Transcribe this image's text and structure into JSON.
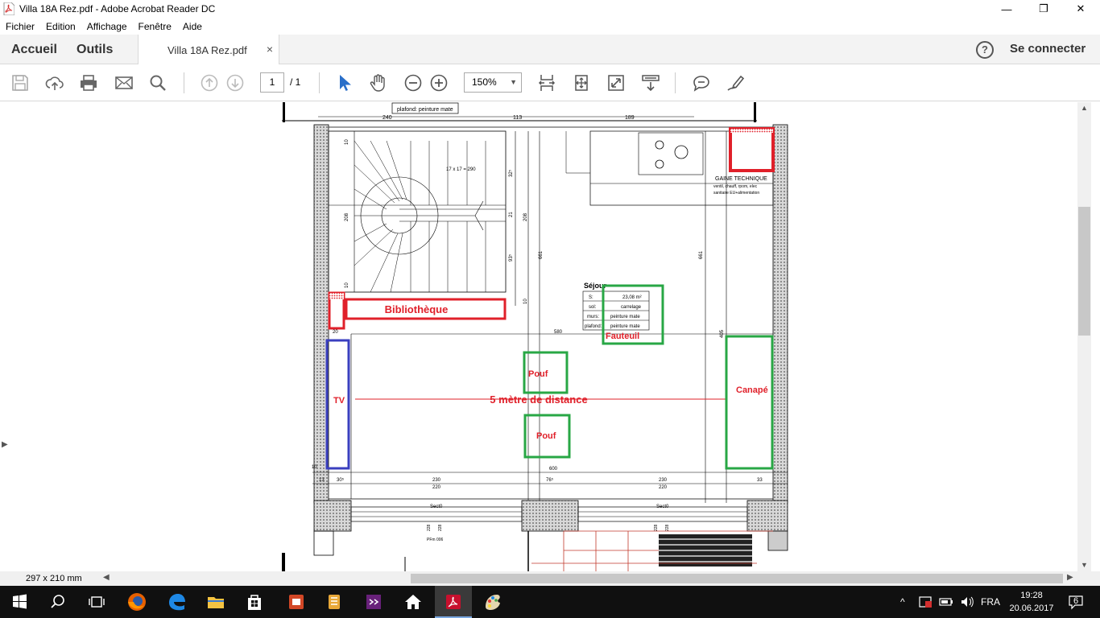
{
  "window": {
    "title": "Villa 18A Rez.pdf - Adobe Acrobat Reader DC",
    "minimize": "—",
    "maximize": "❐",
    "close": "✕"
  },
  "menu": [
    "Fichier",
    "Edition",
    "Affichage",
    "Fenêtre",
    "Aide"
  ],
  "tabs": {
    "home": "Accueil",
    "tools": "Outils",
    "document": "Villa 18A Rez.pdf",
    "close": "×"
  },
  "account": {
    "help": "?",
    "sign_in": "Se connecter"
  },
  "toolbar": {
    "icons": [
      "save-icon",
      "upload-icon",
      "print-icon",
      "email-icon",
      "search-icon",
      "prev-page-icon",
      "next-page-icon",
      "select-cursor-icon",
      "hand-icon",
      "zoom-out-icon",
      "zoom-in-icon",
      "scroll-mode-icon",
      "fit-page-icon",
      "fullscreen-icon",
      "read-mode-icon",
      "comment-icon",
      "sign-icon"
    ],
    "page_current": "1",
    "page_total": "/ 1",
    "zoom": "150%"
  },
  "plan": {
    "top_note": "plafond: peinture mate",
    "top_dims": [
      "240",
      "113",
      "189"
    ],
    "technical": [
      "GAINE TECHNIQUE",
      "ventil, chauff, rpom, elec",
      "sanitaire EU+alimentation"
    ],
    "stair_note": "17 x 17 = 290",
    "room_title": "Séjour",
    "room_table": [
      [
        "S:",
        "23,08 m²"
      ],
      [
        "sol:",
        "carrelage"
      ],
      [
        "murs:",
        "peinture mate"
      ],
      [
        "plafond:",
        "peinture mate"
      ]
    ],
    "left_dims": [
      "10",
      "208",
      "10",
      "20",
      "13",
      "30⁵",
      "10"
    ],
    "vertical_dims": [
      "32⁵",
      "21",
      "208",
      "93⁵",
      "10",
      "661",
      "661",
      "405"
    ],
    "width_dim": "580",
    "bottom_row1": [
      "230",
      "76⁵",
      "230",
      "33"
    ],
    "bottom_row2": [
      "220",
      "220"
    ],
    "bottom_total": "600",
    "section_labels": [
      "Sect0",
      "Sect0"
    ],
    "small_dims": [
      "228",
      "228",
      "228",
      "228"
    ],
    "pf_label": "PFm 006",
    "annotations": {
      "bibliotheque": "Bibliothèque",
      "fauteuil": "Fauteuil",
      "pouf_top": "Pouf",
      "pouf_bottom": "Pouf",
      "tv": "TV",
      "distance": "5 mètre de distance",
      "canape": "Canapé"
    },
    "colors": {
      "red": "#e0202a",
      "green": "#28a745",
      "blue": "#3a3fbf"
    }
  },
  "status": {
    "page_size": "297 x 210 mm"
  },
  "taskbar": {
    "apps": [
      "start-icon",
      "search-icon",
      "task-view-icon",
      "firefox-icon",
      "edge-icon",
      "file-explorer-icon",
      "store-icon",
      "powerpoint-icon",
      "onenote-icon",
      "visual-studio-icon",
      "home-icon",
      "acrobat-icon",
      "paint-icon"
    ],
    "language": "FRA",
    "time": "19:28",
    "date": "20.06.2017",
    "notifications": "6"
  }
}
